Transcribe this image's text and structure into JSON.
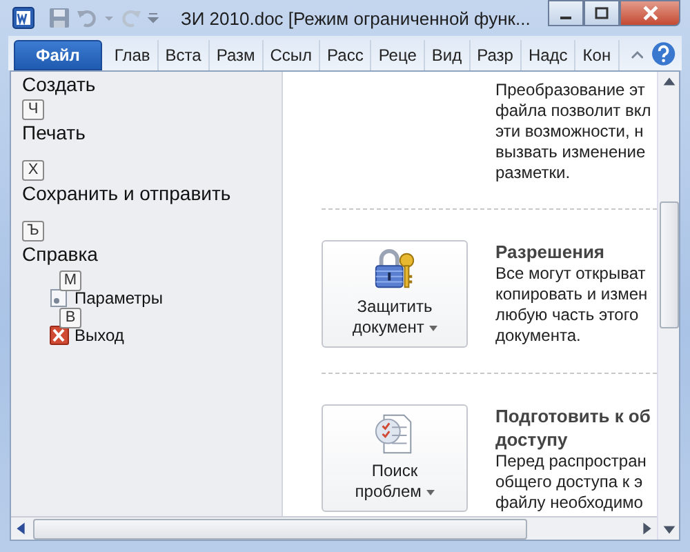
{
  "window": {
    "title": "ЗИ 2010.doc [Режим ограниченной функ..."
  },
  "tabs": [
    {
      "label": "Файл",
      "selected": true
    },
    {
      "label": "Глав",
      "selected": false
    },
    {
      "label": "Вста",
      "selected": false
    },
    {
      "label": "Разм",
      "selected": false
    },
    {
      "label": "Ссыл",
      "selected": false
    },
    {
      "label": "Расс",
      "selected": false
    },
    {
      "label": "Реце",
      "selected": false
    },
    {
      "label": "Вид",
      "selected": false
    },
    {
      "label": "Разр",
      "selected": false
    },
    {
      "label": "Надс",
      "selected": false
    },
    {
      "label": "Кон",
      "selected": false
    }
  ],
  "menu": [
    {
      "label": "Создать",
      "kind": "command"
    },
    {
      "label": "Печать",
      "keytip": "Ч",
      "kind": "command"
    },
    {
      "label": "Сохранить и отправить",
      "keytip": "Х",
      "kind": "command"
    },
    {
      "label": "Справка",
      "keytip": "Ъ",
      "kind": "command"
    },
    {
      "label": "Параметры",
      "keytip": "М",
      "kind": "options"
    },
    {
      "label": "Выход",
      "keytip": "В",
      "kind": "exit"
    }
  ],
  "sections": [
    {
      "lines": [
        "Преобразование эт",
        "файла позволит вкл",
        "эти возможности, н",
        "вызвать изменение",
        "разметки."
      ]
    },
    {
      "button": [
        "Защитить",
        "документ"
      ],
      "heading": [
        "Разрешения"
      ],
      "lines": [
        "Все могут открыват",
        "копировать и измен",
        "любую часть этого",
        "документа."
      ]
    },
    {
      "button": [
        "Поиск",
        "проблем"
      ],
      "heading": [
        "Подготовить к об",
        "доступу"
      ],
      "lines": [
        "Перед распростран",
        "общего доступа к э",
        "файлу необходимо"
      ]
    }
  ]
}
